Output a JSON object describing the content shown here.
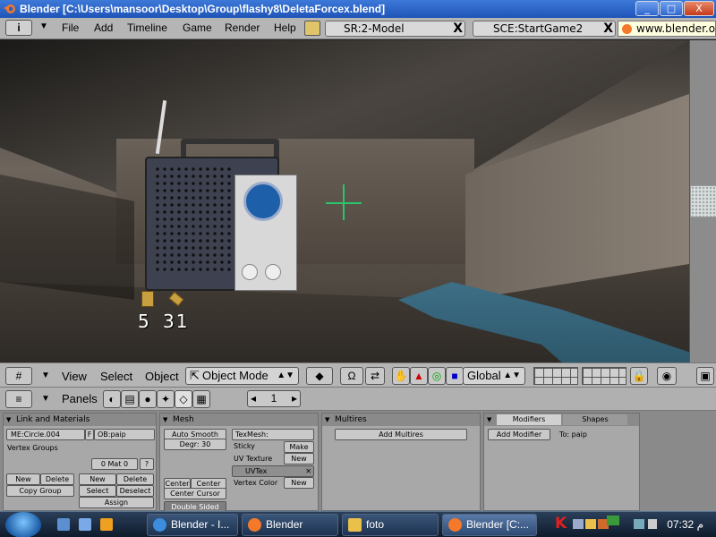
{
  "window": {
    "title": "Blender [C:\\Users\\mansoor\\Desktop\\Group\\flashy8\\DeletaForcex.blend]",
    "minimize": "_",
    "maximize": "□",
    "close": "X"
  },
  "top_header": {
    "info_icon": "i",
    "menus": [
      "File",
      "Add",
      "Timeline",
      "Game",
      "Render",
      "Help"
    ],
    "screen_field": "SR:2-Model",
    "scene_field": "SCE:StartGame2",
    "close_x": "X",
    "url": "www.blender.or"
  },
  "hud": {
    "left_count": "5",
    "right_count": "31"
  },
  "view_header": {
    "menus": [
      "View",
      "Select",
      "Object"
    ],
    "mode": "Object Mode",
    "orientation": "Global"
  },
  "buttons_header": {
    "panels_label": "Panels",
    "frame_value": "1"
  },
  "link_panel": {
    "title": "Link and Materials",
    "me_field": "ME:Circle.004",
    "f_label": "F",
    "ob_field": "OB:paip",
    "vertex_groups": "Vertex Groups",
    "mat_field": "0 Mat 0",
    "question": "?",
    "new": "New",
    "delete": "Delete",
    "copy_group": "Copy Group",
    "new2": "New",
    "delete2": "Delete",
    "select": "Select",
    "deselect": "Deselect",
    "assign": "Assign"
  },
  "mesh_panel": {
    "title": "Mesh",
    "auto_smooth": "Auto Smooth",
    "degr": "Degr: 30",
    "texmesh": "TexMesh:",
    "sticky": "Sticky",
    "make": "Make",
    "uv_texture": "UV Texture",
    "new": "New",
    "uvtex": "UVTex",
    "vertex_color": "Vertex Color",
    "new2": "New",
    "center": "Center",
    "center_new": "Center New",
    "center_cursor": "Center Cursor",
    "double_sided": "Double Sided"
  },
  "multires_panel": {
    "title": "Multires",
    "add_multires": "Add Multires"
  },
  "modifiers_panel": {
    "tab_modifiers": "Modifiers",
    "tab_shapes": "Shapes",
    "add_modifier": "Add Modifier",
    "to_label": "To: paip"
  },
  "taskbar": {
    "items": [
      "Blender - I...",
      "Blender",
      "foto",
      "Blender [C:..."
    ],
    "tray_k": "K",
    "clock": "07:32 م"
  },
  "colors": {
    "title_blue": "#1f54b8",
    "blender_gray": "#b5b5b5",
    "crosshair": "#28c56a",
    "selected_tab": "#d9d9d9"
  }
}
